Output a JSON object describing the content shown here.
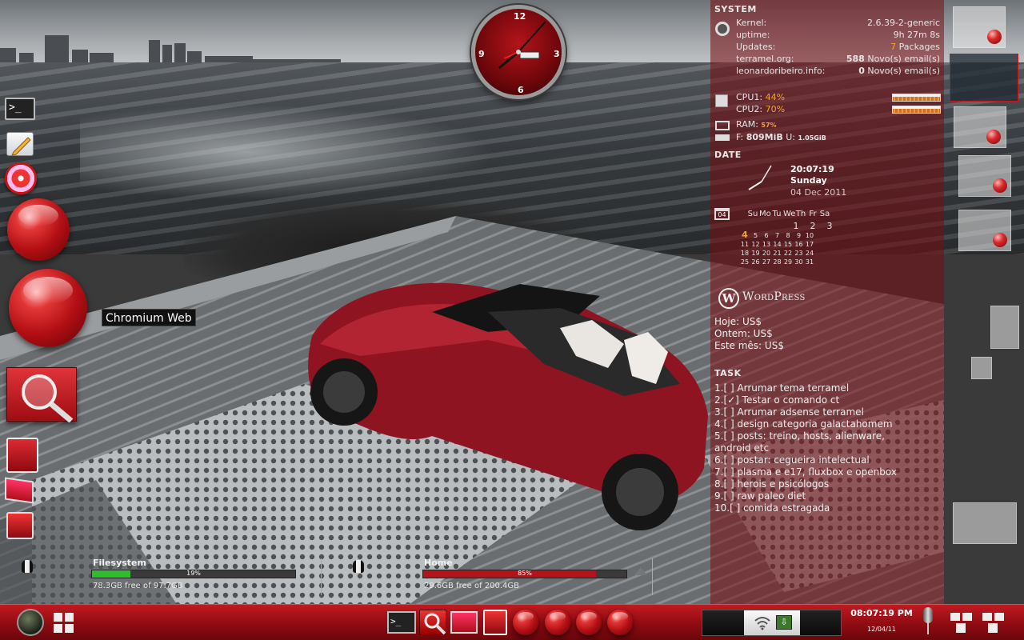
{
  "tooltip": "Chromium Web",
  "clock": {
    "n12": "12",
    "n3": "3",
    "n6": "6",
    "n9": "9"
  },
  "system": {
    "header": "SYSTEM",
    "kernel_label": "Kernel:",
    "kernel_value": "2.6.39-2-generic",
    "uptime_label": "uptime:",
    "uptime_value": "9h 27m 8s",
    "updates_label": "Updates:",
    "updates_count": "7",
    "updates_unit": " Packages",
    "mail1_label": "terramel.org:",
    "mail1_count": "588",
    "mail1_unit": " Novo(s) email(s)",
    "mail2_label": "leonardoribeiro.info:",
    "mail2_count": "0",
    "mail2_unit": " Novo(s) email(s)",
    "cpu1_label": "CPU1:",
    "cpu1_value": "44%",
    "cpu2_label": "CPU2:",
    "cpu2_value": "70%",
    "ram_label": "RAM:",
    "ram_value": "57%",
    "f_label": "F:",
    "f_value": "809MiB",
    "u_label": "U:",
    "u_value": "1.05GiB"
  },
  "date": {
    "header": "DATE",
    "time": "20:07:19",
    "weekday": "Sunday",
    "full": "04 Dec 2011",
    "cal_icon": "04",
    "weekdays": [
      "Su",
      "Mo",
      "Tu",
      "We",
      "Th",
      "Fr",
      "Sa"
    ],
    "rows": [
      [
        "",
        "",
        "",
        "",
        "1",
        "2",
        "3"
      ],
      [
        "4",
        "5",
        "6",
        "7",
        "8",
        "9",
        "10"
      ],
      [
        "11",
        "12",
        "13",
        "14",
        "15",
        "16",
        "17"
      ],
      [
        "18",
        "19",
        "20",
        "21",
        "22",
        "23",
        "24"
      ],
      [
        "25",
        "26",
        "27",
        "28",
        "29",
        "30",
        "31"
      ]
    ]
  },
  "wordpress": {
    "logo": "WordPress",
    "today": "Hoje: US$",
    "yesterday": "Ontem: US$",
    "month": "Este mês: US$"
  },
  "task": {
    "header": "TASK",
    "items": [
      "1.[   ] Arrumar tema terramel",
      "2.[✓] Testar o comando ct",
      "3.[   ] Arrumar adsense terramel",
      "4.[   ] design categoria galactahomem",
      "5.[   ] posts: treino, hosts, alienware,",
      " android etc",
      "6.[   ] postar: cegueira intelectual",
      "7.[   ] plasma e e17, fluxbox e openbox",
      "8.[   ] herois e psicólogos",
      "9.[   ] raw paleo diet",
      "10.[   ] comida estragada"
    ]
  },
  "filesystem": {
    "title": "Filesystem",
    "percent": "19%",
    "fraction": 0.19,
    "free": "78.3GB free of 97.7GB"
  },
  "home": {
    "title": "Home",
    "percent": "85%",
    "fraction": 0.85,
    "free": "29.6GB free of 200.4GB"
  },
  "taskbar": {
    "time": "08:07:19 PM",
    "date": "12/04/11"
  },
  "colors": {
    "accent": "#b3141b",
    "highlight": "#f2a23c",
    "fs_bar": "#2fbd2f",
    "home_bar": "#b3141b"
  }
}
